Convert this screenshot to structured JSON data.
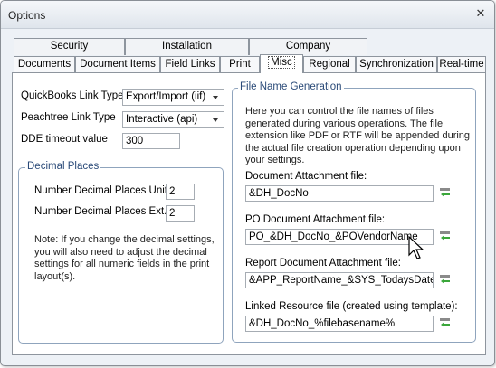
{
  "window": {
    "title": "Options",
    "close_glyph": "✕"
  },
  "tabs_back": [
    "Security",
    "Installation",
    "Company"
  ],
  "tabs_front": [
    "Documents",
    "Document Items",
    "Field Links",
    "Print",
    "Misc",
    "Regional",
    "Synchronization",
    "Real-time"
  ],
  "active_tab": "Misc",
  "left": {
    "qb_label": "QuickBooks Link Type",
    "qb_value": "Export/Import (iif)",
    "pt_label": "Peachtree Link Type",
    "pt_value": "Interactive (api)",
    "dde_label": "DDE timeout value",
    "dde_value": "300",
    "decimal": {
      "title": "Decimal Places",
      "unit_label": "Number Decimal Places Unit",
      "unit_value": "2",
      "ext_label": "Number Decimal Places Ext.",
      "ext_value": "2",
      "note": "Note: If you change the decimal settings, you will also need to adjust the decimal settings for all numeric fields in the print layout(s)."
    }
  },
  "right": {
    "title": "File Name Generation",
    "description": "Here you can control the file names of files generated during various operations. The file extension like PDF or RTF will be appended during the actual file creation operation depending upon your settings.",
    "fields": [
      {
        "label": "Document Attachment file:",
        "value": "&DH_DocNo"
      },
      {
        "label": "PO Document Attachment file:",
        "value": "PO_&DH_DocNo_&POVendorName"
      },
      {
        "label": "Report Document Attachment file:",
        "value": "&APP_ReportName_&SYS_TodaysDate"
      },
      {
        "label": "Linked Resource file (created using template):",
        "value": "&DH_DocNo_%filebasename%"
      }
    ]
  },
  "colors": {
    "accent": "#2a4a78",
    "icon_green": "#3aa63a",
    "icon_gray": "#8a8a8a"
  }
}
